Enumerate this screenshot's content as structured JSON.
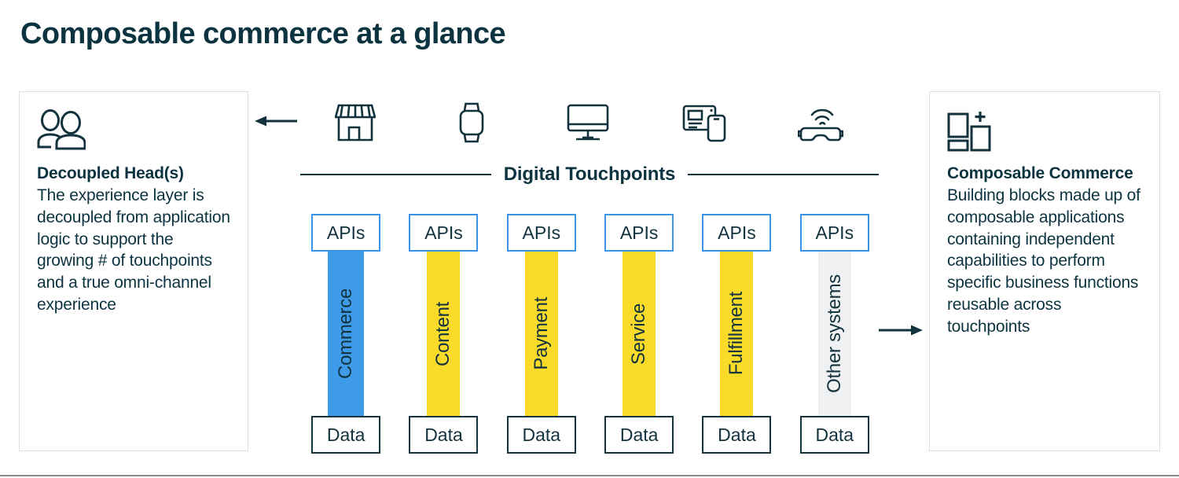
{
  "page": {
    "title": "Composable commerce at a glance",
    "background_color": "#FFFFFF",
    "text_color": "#0C3340"
  },
  "left_panel": {
    "icon": "two-people-icon",
    "heading": "Decoupled Head(s)",
    "body": "The experience layer is decoupled from application logic to support the growing # of touchpoints and a true omni-channel experience"
  },
  "right_panel": {
    "icon": "building-blocks-plus-icon",
    "heading": "Composable Commerce",
    "body": "Building blocks made up of composable applications containing independent capabilities to perform specific business functions reusable across touchpoints"
  },
  "arrows": {
    "left": "arrow-left-icon",
    "right": "arrow-right-icon"
  },
  "touchpoints": {
    "label": "Digital Touchpoints",
    "icons": [
      {
        "name": "storefront-icon",
        "label": "Storefront"
      },
      {
        "name": "smartwatch-icon",
        "label": "Smartwatch"
      },
      {
        "name": "desktop-monitor-icon",
        "label": "Desktop"
      },
      {
        "name": "tablet-phone-icon",
        "label": "Tablet and phone"
      },
      {
        "name": "vr-headset-icon",
        "label": "VR headset"
      }
    ]
  },
  "columns": {
    "api_label": "APIs",
    "data_label": "Data",
    "items": [
      {
        "name": "Commerce",
        "color": "#3E9BE9",
        "style": "commerce"
      },
      {
        "name": "Content",
        "color": "#FADB2A",
        "style": "yellow"
      },
      {
        "name": "Payment",
        "color": "#FADB2A",
        "style": "yellow"
      },
      {
        "name": "Service",
        "color": "#FADB2A",
        "style": "yellow"
      },
      {
        "name": "Fulfillment",
        "color": "#FADB2A",
        "style": "yellow"
      },
      {
        "name": "Other systems",
        "color": "#EFF0F1",
        "style": "grey"
      }
    ]
  },
  "colors": {
    "accent_blue": "#3E9BE9",
    "accent_yellow": "#FADB2A",
    "accent_grey": "#EFF0F1",
    "api_border": "#3B93E8",
    "data_border": "#12323E",
    "panel_border": "#DEDEDE",
    "heading": "#0C3340"
  }
}
